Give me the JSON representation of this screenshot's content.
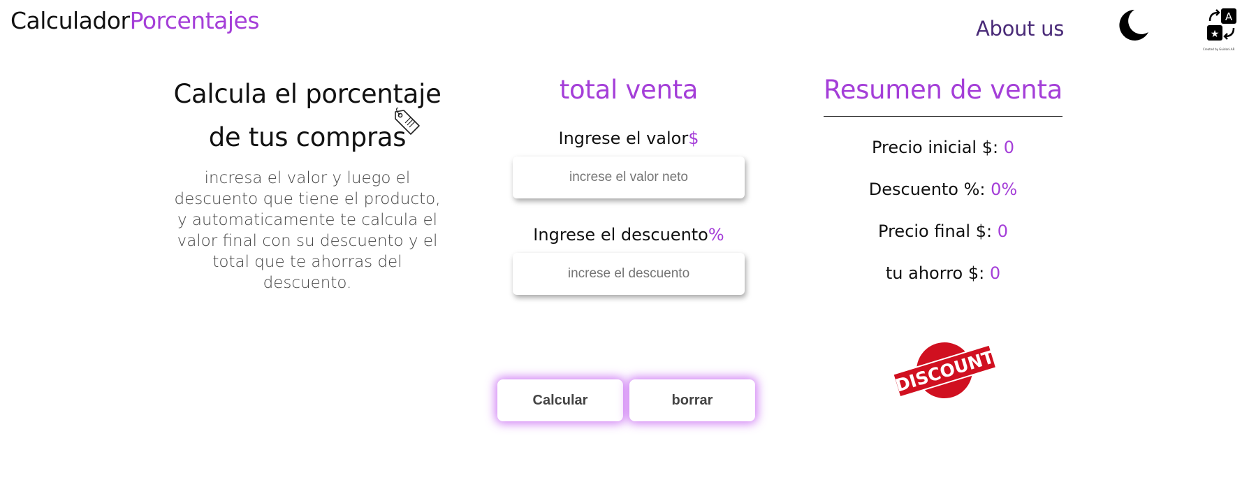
{
  "header": {
    "logo_main": "Calculador",
    "logo_accent": "Porcentajes",
    "about_label": "About us",
    "moon_icon": "moon-icon",
    "translate_icon": "translate-icon",
    "translate_caption": "Created by Guidoni.AR"
  },
  "intro": {
    "title_line1": "Calcula el porcentaje",
    "title_line2": "de tus compras",
    "tag_icon": "price-tag-icon",
    "description": "incresa el valor y luego el descuento que tiene el producto, y automaticamente te calcula el valor final con su descuento y el total que te ahorras del descuento."
  },
  "form": {
    "title": "total venta",
    "value_label": "Ingrese el valor",
    "value_symbol": "$",
    "value_placeholder": "increse el valor neto",
    "discount_label": "Ingrese el descuento",
    "discount_symbol": "%",
    "discount_placeholder": "increse el descuento",
    "calc_label": "Calcular",
    "clear_label": "borrar"
  },
  "summary": {
    "title": "Resumen de venta",
    "initial_label": "Precio inicial $: ",
    "initial_value": "0",
    "discount_label": "Descuento %: ",
    "discount_value": "0%",
    "final_label": "Precio final $: ",
    "final_value": "0",
    "saving_label": "tu ahorro $: ",
    "saving_value": "0",
    "stamp_text": "DISCOUNT"
  },
  "colors": {
    "accent": "#a43ed8",
    "about": "#4a2b78",
    "stamp_red": "#d01020"
  }
}
